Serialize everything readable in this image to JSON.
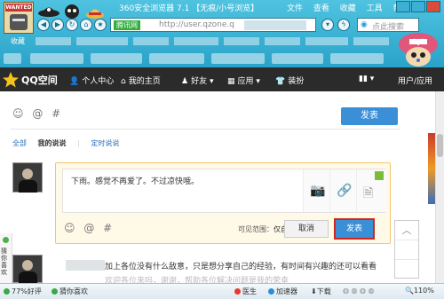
{
  "browser": {
    "title": "360安全浏览器 7.1 【无痕/小号浏览】",
    "menu": [
      "文件",
      "查看",
      "收藏",
      "工具",
      "帮助"
    ],
    "address_tag": "腾讯网",
    "address_url": "http://user.qzone.q",
    "search_placeholder": "点此搜索",
    "favorites_label": "收藏"
  },
  "qzone_nav": {
    "title": "QQ空间",
    "items": [
      {
        "icon": "person-icon",
        "label": "个人中心"
      },
      {
        "icon": "home-icon",
        "label": "我的主页"
      },
      {
        "icon": "friends-icon",
        "label": "好友"
      },
      {
        "icon": "apps-icon",
        "label": "应用"
      },
      {
        "icon": "shirt-icon",
        "label": "装扮"
      }
    ],
    "user_label": "用户/应用"
  },
  "top_compose": {
    "publish_label": "发表"
  },
  "feed_tabs": {
    "all": "全部",
    "mine": "我的说说",
    "scheduled": "定时说说"
  },
  "compose": {
    "text": "下雨。感觉不再爱了。不过凉快哦。",
    "visibility_label": "可见范围：",
    "visibility_value": "仅自己",
    "cancel_label": "取消",
    "publish_label": "发表"
  },
  "side": {
    "label": "猜你喜欢"
  },
  "post": {
    "text": "加上各位没有什么敌意，只是想分享自己的经验，有时间有兴趣的还可以看看",
    "text2": "欢迎各位来吗，谢谢，帮助各位解决问题是我的荣幸"
  },
  "status_bar": {
    "rating": "77%好评",
    "guess": "猜你喜欢",
    "doctor": "医生",
    "accelerator": "加速器",
    "download": "下载",
    "zoom": "110%"
  }
}
